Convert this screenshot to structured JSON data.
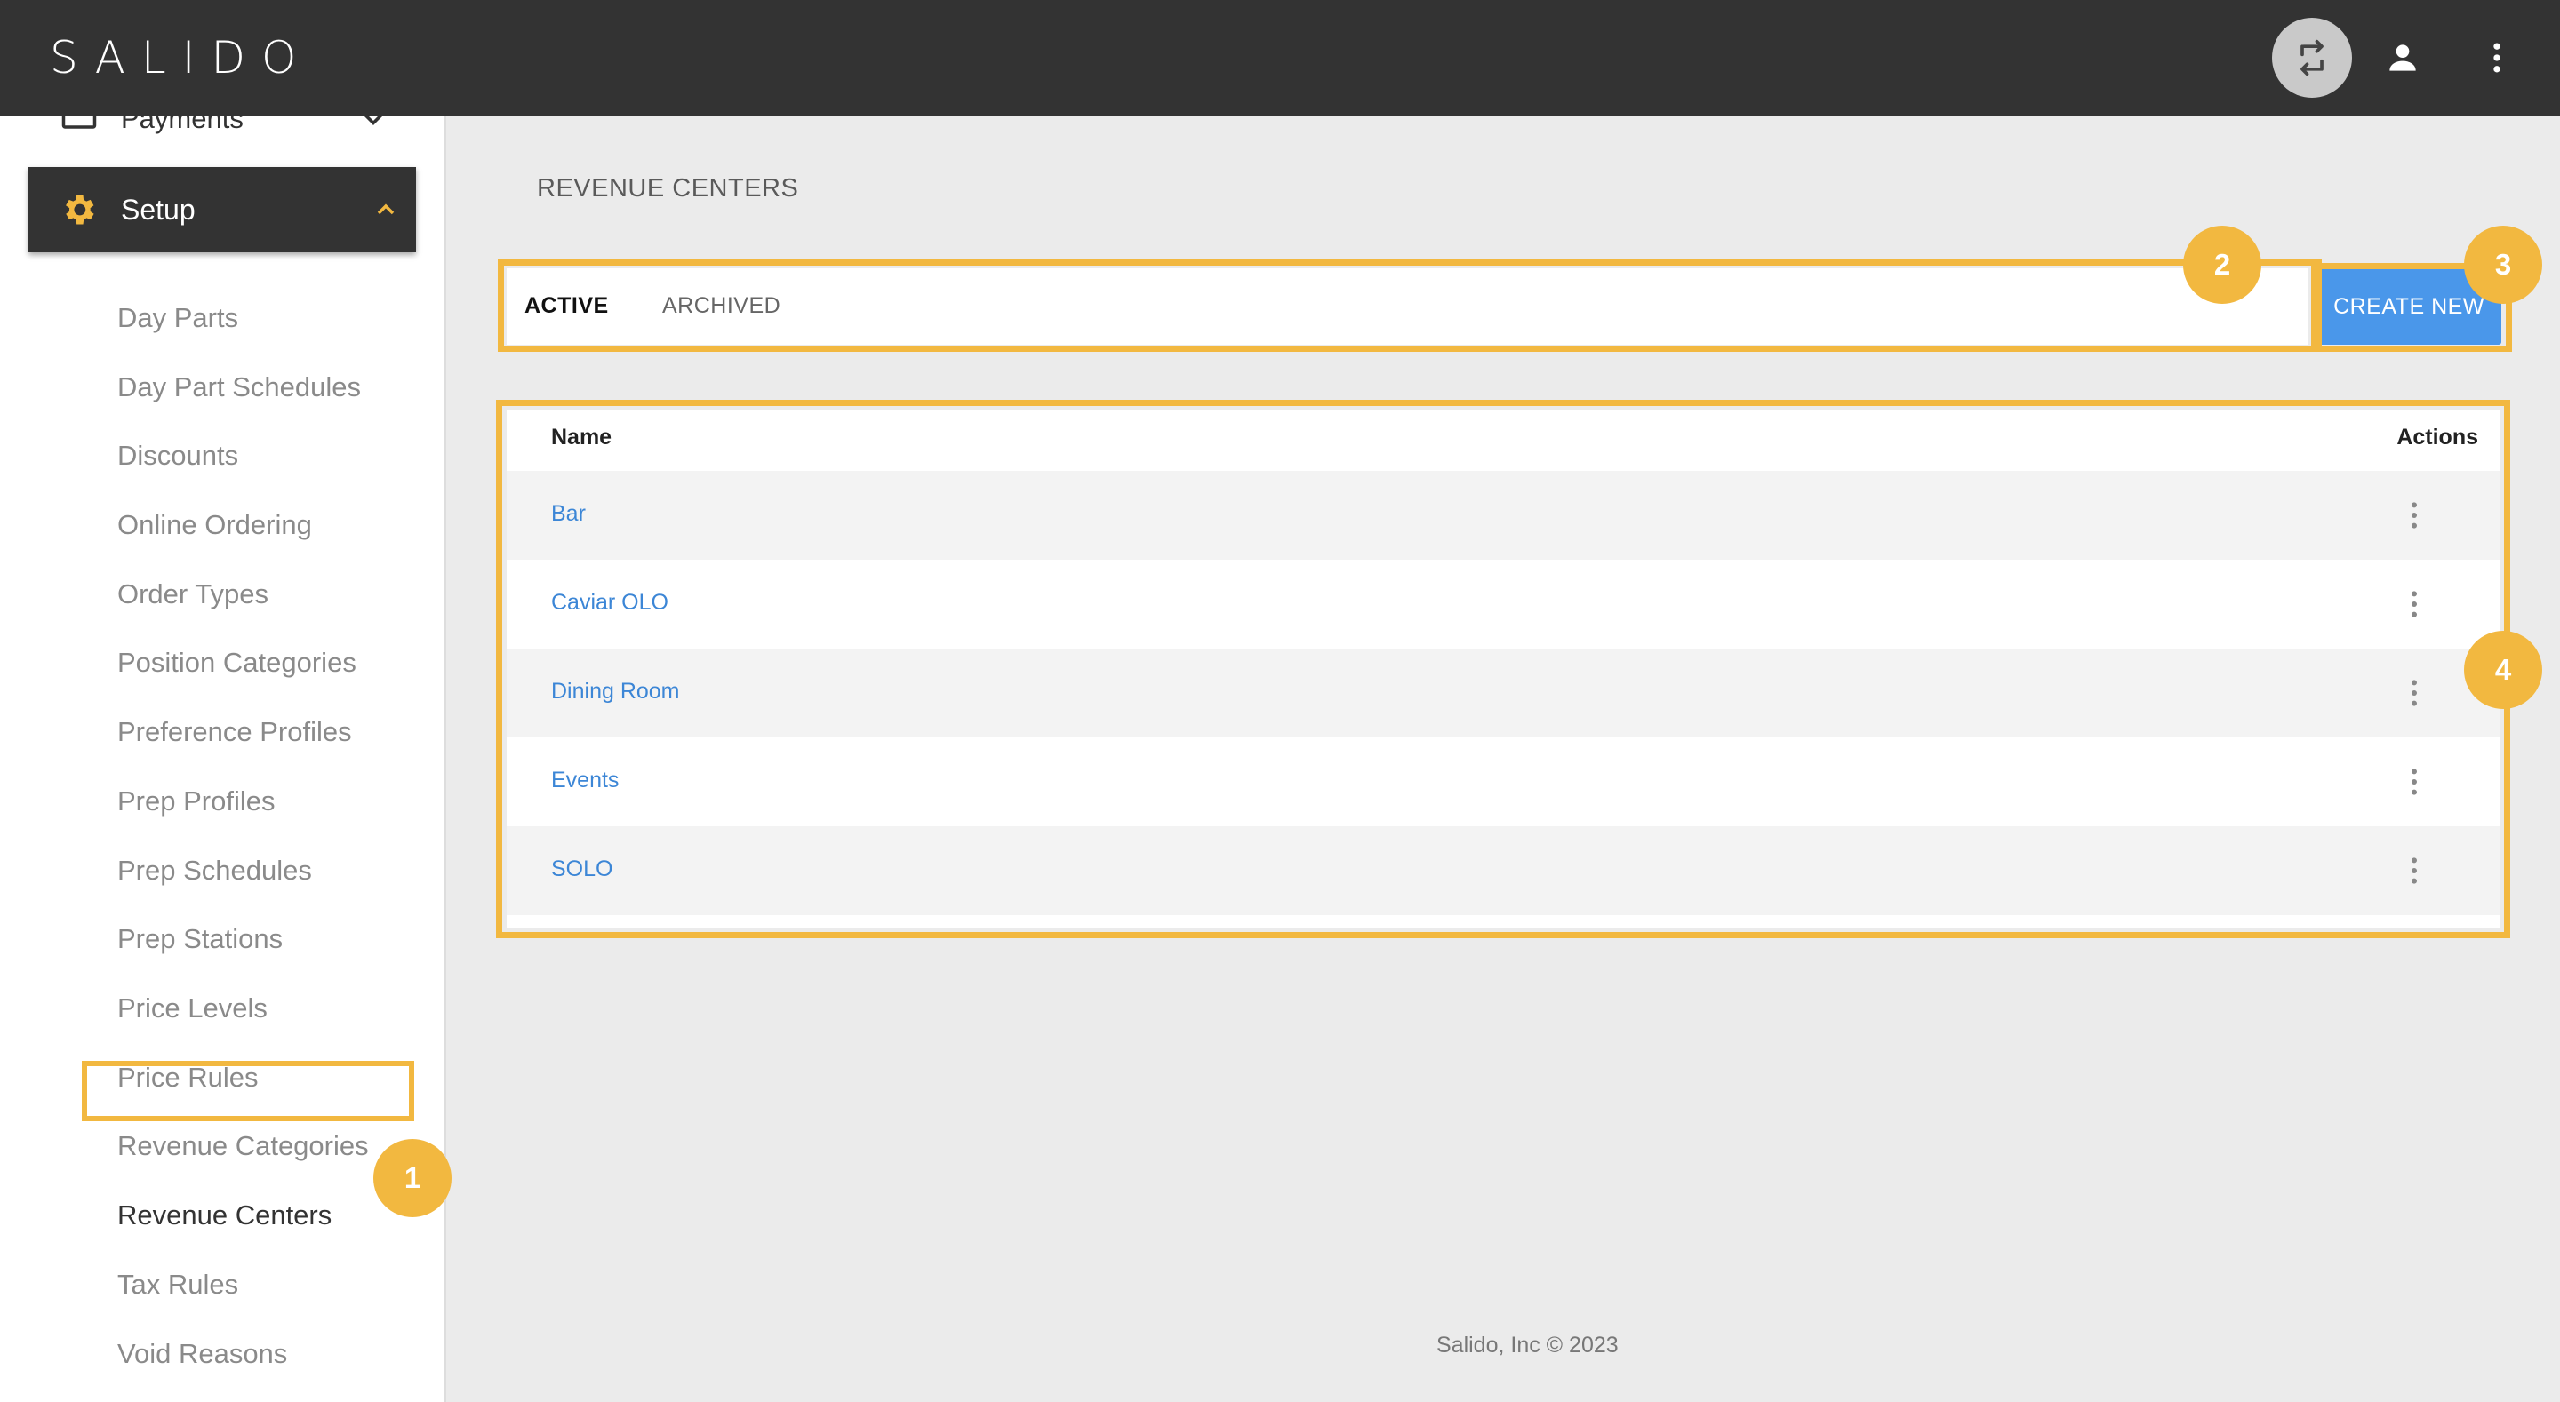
{
  "header": {
    "logo": "SALIDO",
    "icons": [
      "swap-icon",
      "user-icon",
      "more-vert-icon"
    ]
  },
  "sidebar": {
    "payments_label": "Payments",
    "setup_label": "Setup",
    "items": [
      {
        "label": "Day Parts"
      },
      {
        "label": "Day Part Schedules"
      },
      {
        "label": "Discounts"
      },
      {
        "label": "Online Ordering"
      },
      {
        "label": "Order Types"
      },
      {
        "label": "Position Categories"
      },
      {
        "label": "Preference Profiles"
      },
      {
        "label": "Prep Profiles"
      },
      {
        "label": "Prep Schedules"
      },
      {
        "label": "Prep Stations"
      },
      {
        "label": "Price Levels"
      },
      {
        "label": "Price Rules"
      },
      {
        "label": "Revenue Categories"
      },
      {
        "label": "Revenue Centers"
      },
      {
        "label": "Tax Rules"
      },
      {
        "label": "Void Reasons"
      }
    ],
    "active_item": "Revenue Centers"
  },
  "main": {
    "page_title": "REVENUE CENTERS",
    "tabs": [
      {
        "label": "ACTIVE",
        "active": true
      },
      {
        "label": "ARCHIVED",
        "active": false
      }
    ],
    "create_button": "CREATE NEW",
    "table": {
      "columns": [
        "Name",
        "Actions"
      ],
      "rows": [
        {
          "name": "Bar"
        },
        {
          "name": "Caviar OLO"
        },
        {
          "name": "Dining Room"
        },
        {
          "name": "Events"
        },
        {
          "name": "SOLO"
        }
      ]
    }
  },
  "annotations": [
    "1",
    "2",
    "3",
    "4"
  ],
  "colors": {
    "topbar": "#333333",
    "accent_highlight": "#f2b840",
    "primary_button": "#4a97ea",
    "link": "#3c86d6",
    "sidebar_text": "#8a8a8a"
  },
  "footer": "Salido, Inc © 2023"
}
